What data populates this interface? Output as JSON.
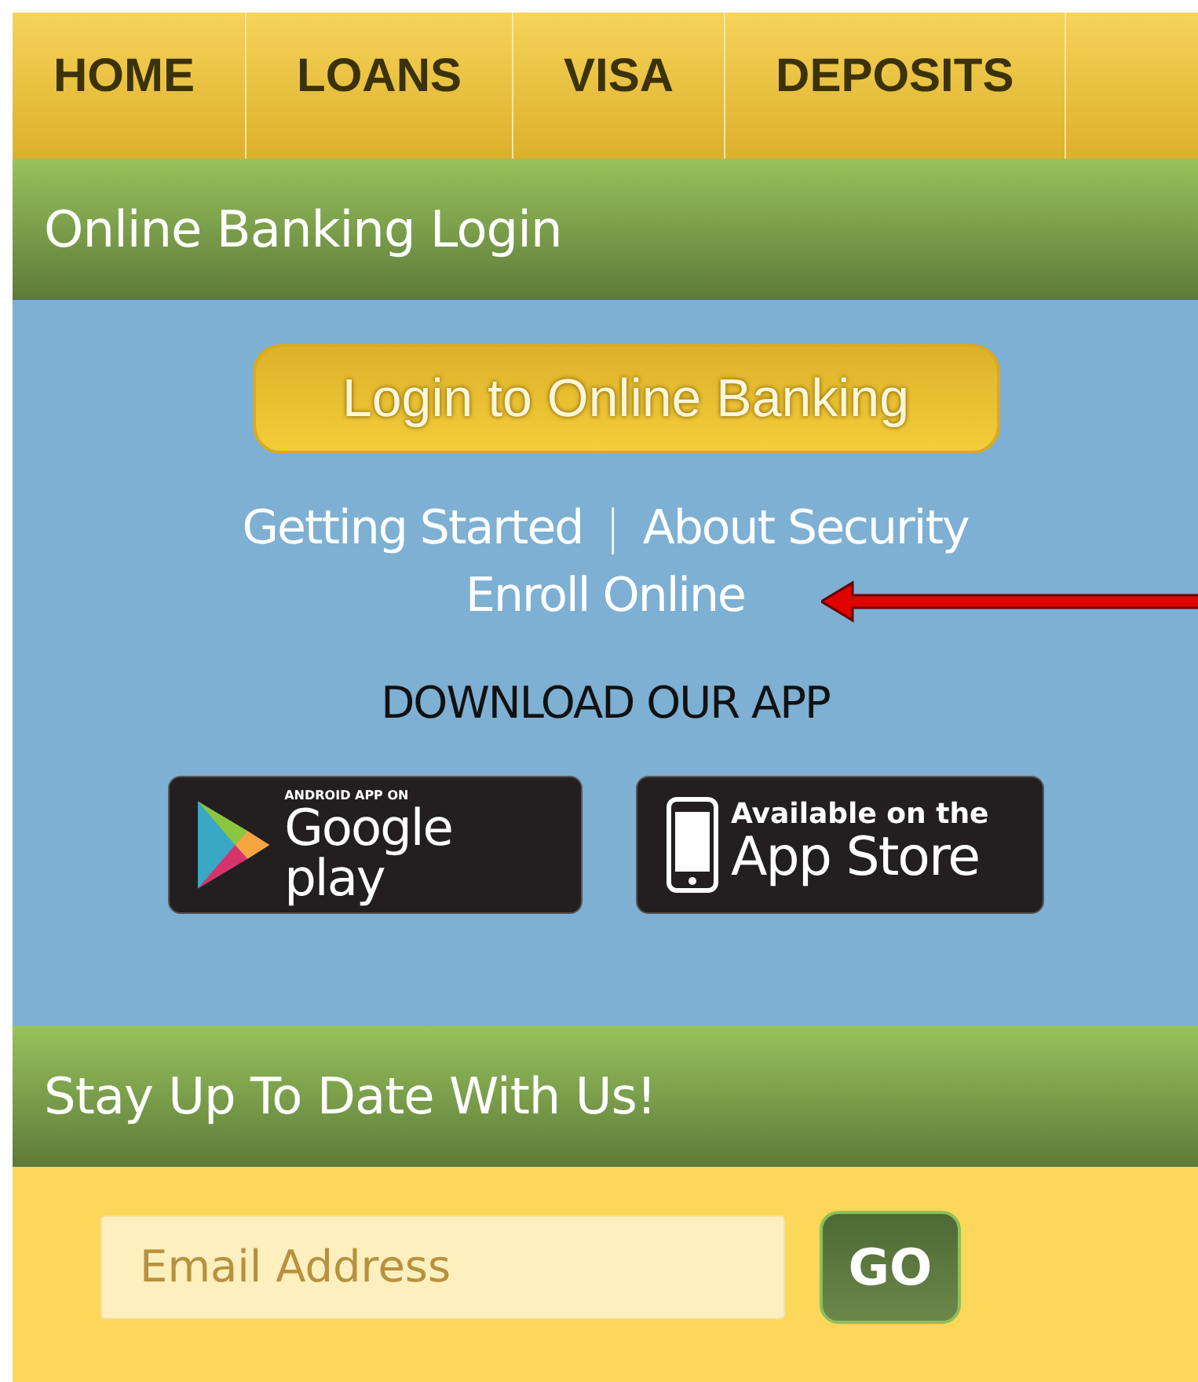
{
  "nav": [
    {
      "label": "HOME"
    },
    {
      "label": "LOANS"
    },
    {
      "label": "VISA"
    },
    {
      "label": "DEPOSITS"
    }
  ],
  "login_section": {
    "title": "Online Banking Login",
    "login_button": "Login to Online Banking",
    "links": [
      "Getting Started",
      "About Security"
    ],
    "separator": "|",
    "enroll_link": "Enroll Online",
    "app_heading": "DOWNLOAD OUR APP",
    "badges": [
      {
        "kind": "google",
        "small_text": "ANDROID APP ON",
        "big_text": "Google play"
      },
      {
        "kind": "apple",
        "small_text": "Available on the",
        "big_text": "App Store"
      }
    ]
  },
  "newsletter": {
    "title": "Stay Up To Date With Us!",
    "email": {
      "placeholder": "Email Address"
    },
    "button": "GO"
  }
}
